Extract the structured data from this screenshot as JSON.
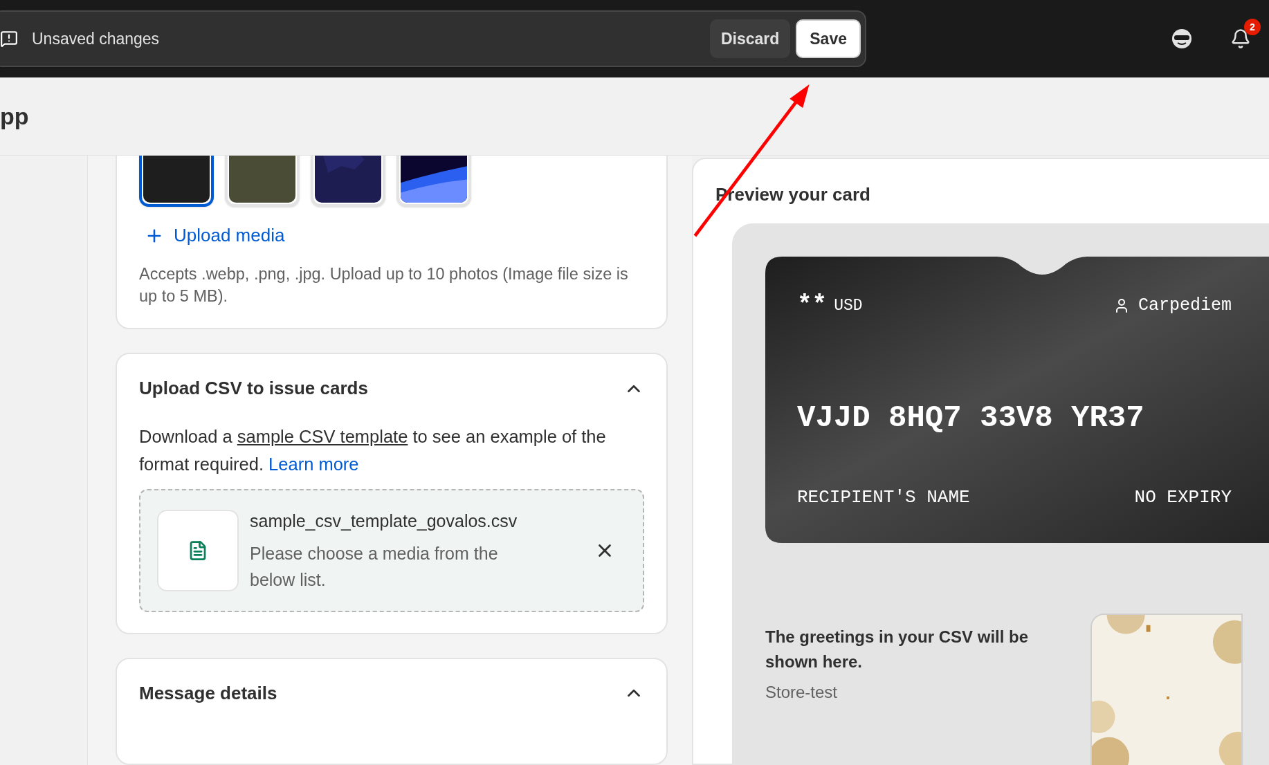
{
  "unsaved_bar": {
    "message": "Unsaved changes",
    "buttons": [
      {
        "label": "Discard",
        "kind": "secondary"
      },
      {
        "label": "Save",
        "kind": "primary"
      }
    ]
  },
  "notifications": {
    "count": "2"
  },
  "page_title": "pp",
  "media": {
    "thumbnails": [
      {
        "kind": "picture",
        "selected": true,
        "color": "#1e1e1e"
      },
      {
        "kind": "picture",
        "selected": false,
        "color": "#4a4c36"
      },
      {
        "kind": "picture",
        "selected": false,
        "color": "#1e1d52"
      },
      {
        "kind": "picture",
        "selected": false,
        "color": "#0b0630"
      }
    ],
    "upload_link": "Upload media",
    "help": "Accepts .webp, .png, .jpg. Upload up to 10 photos (Image file size is up to 5 MB)."
  },
  "csv_section": {
    "title": "Upload CSV to issue cards",
    "expanded": true,
    "text_before": "Download a",
    "template_link": "sample CSV template",
    "text_after": "to see an example of the format required.",
    "learn_more": "Learn more",
    "file": {
      "name": "sample_csv_template_govalos.csv",
      "message": "Please choose a media from the below list."
    }
  },
  "message_section": {
    "title": "Message details",
    "expanded": true
  },
  "preview": {
    "title": "Preview your card",
    "card": {
      "balance": "**",
      "currency": "USD",
      "store": "Carpediem",
      "code": "VJJD 8HQ7 33V8 YR37",
      "recipient": "RECIPIENT'S NAME",
      "expiry": "NO EXPIRY"
    },
    "greeting": "The greetings in your CSV will be shown here.",
    "sender": "Store-test"
  }
}
